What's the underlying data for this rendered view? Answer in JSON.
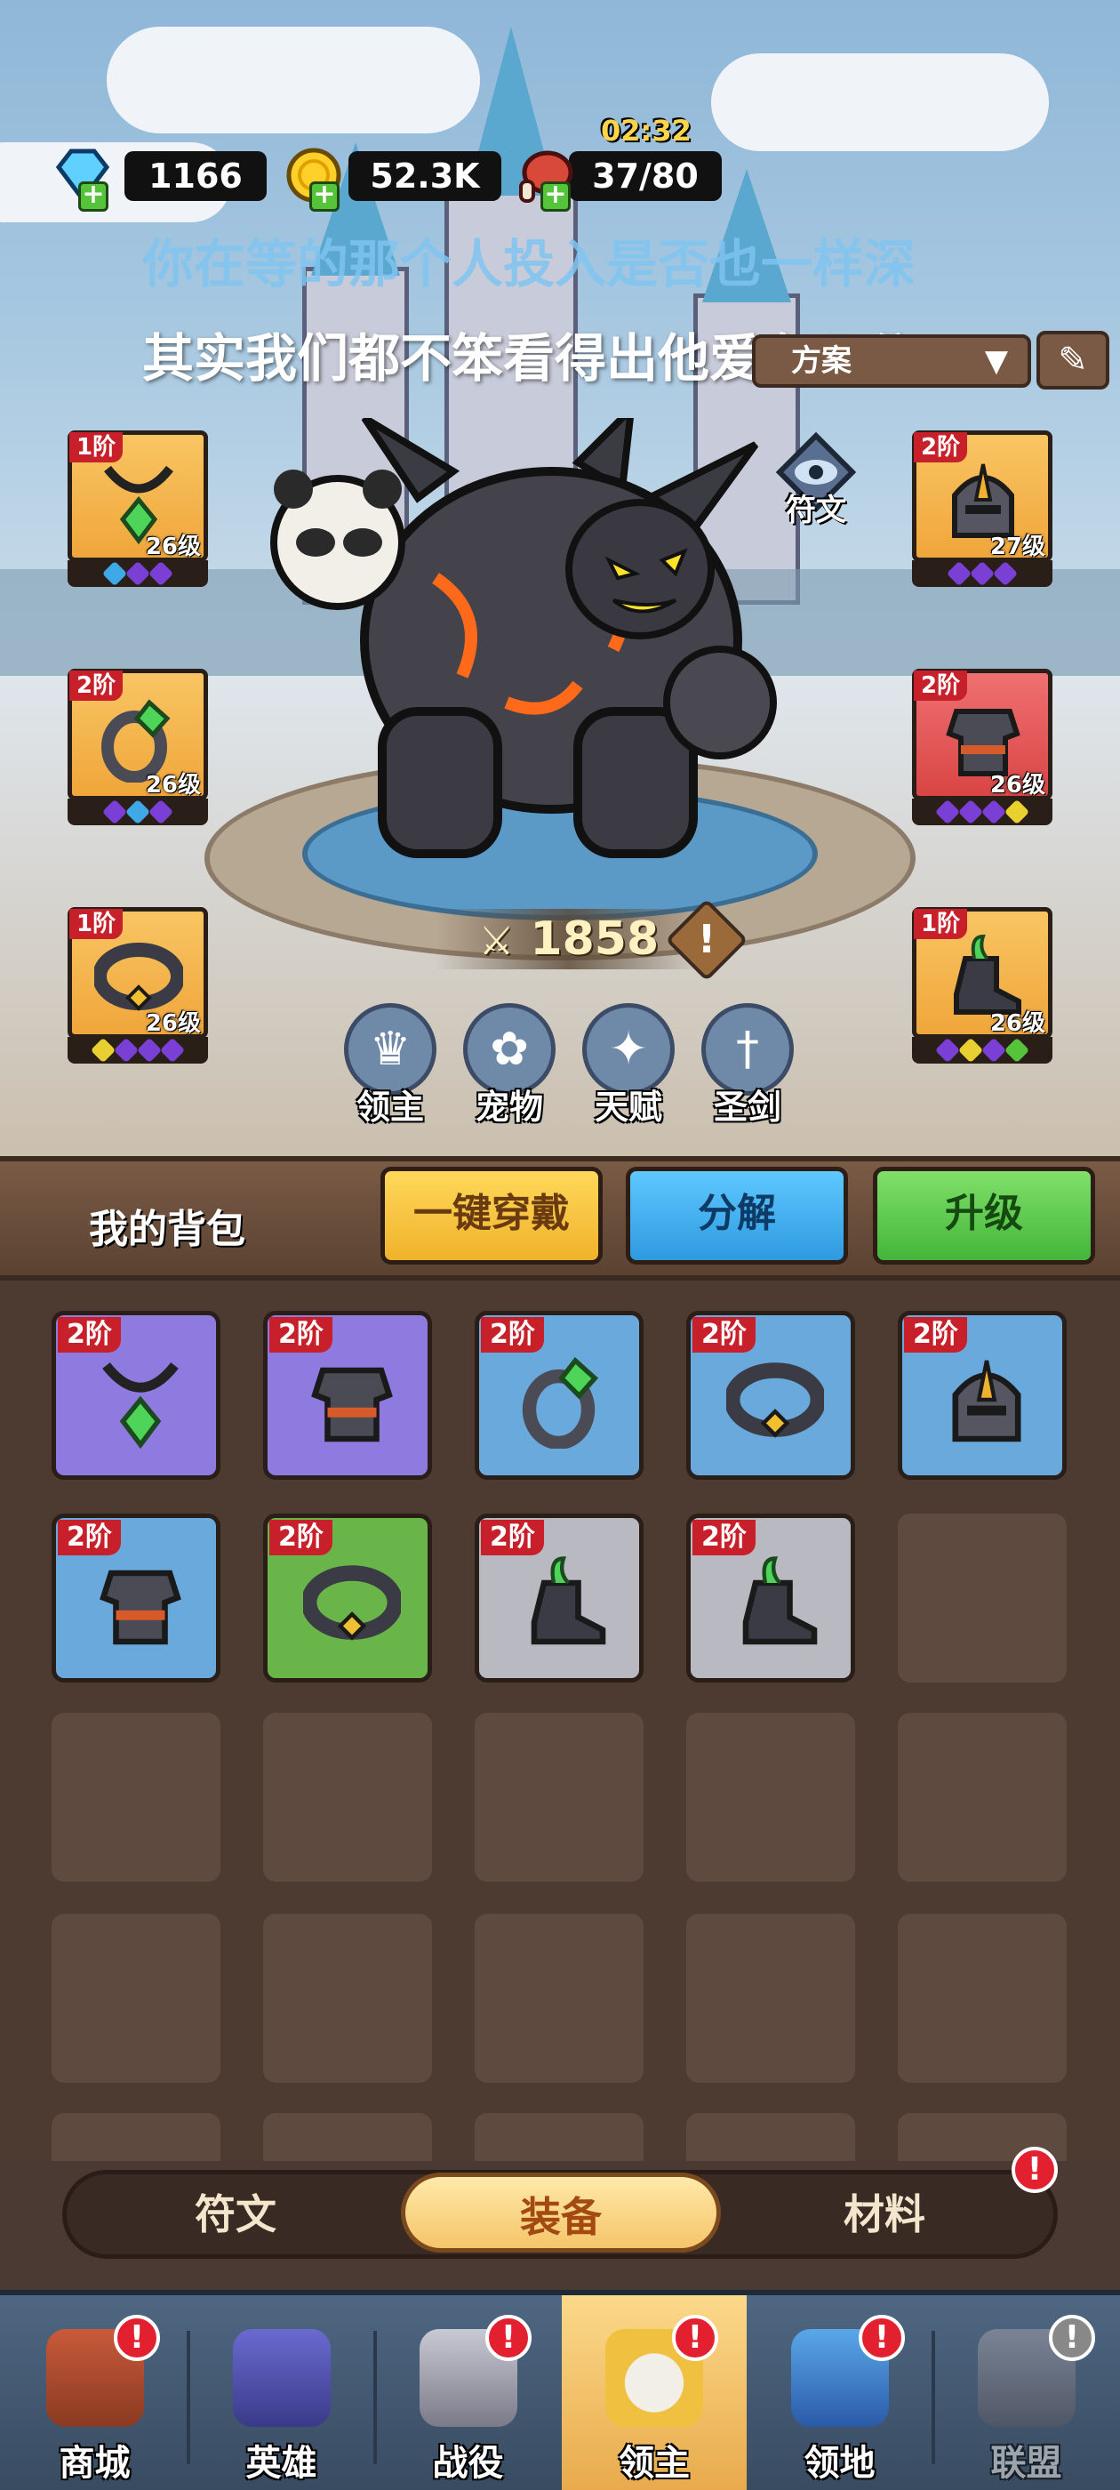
{
  "resources": {
    "gems": "1166",
    "gold": "52.3K",
    "stamina": "37/80",
    "stamina_timer": "02:32"
  },
  "lyrics": {
    "line1": "你在等的那个人投入是否也一样深",
    "line2": "其实我们都不笨看得出他爱有几分"
  },
  "preset": {
    "label": "方案"
  },
  "rune_label": "符文",
  "equipped": [
    {
      "slot": "necklace",
      "tier": "1阶",
      "level": "26级",
      "gems": [
        "#3fa9e8",
        "#7a3fd4",
        "#7a3fd4"
      ]
    },
    {
      "slot": "helmet",
      "tier": "2阶",
      "level": "27级",
      "gems": [
        "#7a3fd4",
        "#7a3fd4",
        "#7a3fd4"
      ]
    },
    {
      "slot": "ring",
      "tier": "2阶",
      "level": "26级",
      "gems": [
        "#7a3fd4",
        "#3fa9e8",
        "#7a3fd4"
      ]
    },
    {
      "slot": "armor",
      "tier": "2阶",
      "level": "26级",
      "gems": [
        "#7a3fd4",
        "#7a3fd4",
        "#7a3fd4",
        "#e8d030"
      ]
    },
    {
      "slot": "belt",
      "tier": "1阶",
      "level": "26级",
      "gems": [
        "#e8d030",
        "#7a3fd4",
        "#7a3fd4",
        "#7a3fd4"
      ]
    },
    {
      "slot": "boots",
      "tier": "1阶",
      "level": "26级",
      "gems": [
        "#7a3fd4",
        "#e8d030",
        "#7a3fd4",
        "#55c43a"
      ]
    }
  ],
  "power": "1858",
  "functions": [
    "领主",
    "宠物",
    "天赋",
    "圣剑"
  ],
  "bag": {
    "title": "我的背包",
    "btn_equip_all": "一键穿戴",
    "btn_decompose": "分解",
    "btn_upgrade": "升级"
  },
  "bag_items": [
    {
      "tier": "2阶",
      "item": "necklace",
      "rarity_color": "#8f7ae0"
    },
    {
      "tier": "2阶",
      "item": "armor",
      "rarity_color": "#8f7ae0"
    },
    {
      "tier": "2阶",
      "item": "ring",
      "rarity_color": "#6aa9dc"
    },
    {
      "tier": "2阶",
      "item": "belt",
      "rarity_color": "#6aa9dc"
    },
    {
      "tier": "2阶",
      "item": "helmet",
      "rarity_color": "#6aa9dc"
    },
    {
      "tier": "2阶",
      "item": "armor",
      "rarity_color": "#6aa9dc"
    },
    {
      "tier": "2阶",
      "item": "belt",
      "rarity_color": "#6ab54a"
    },
    {
      "tier": "2阶",
      "item": "boots",
      "rarity_color": "#b9b9c2"
    },
    {
      "tier": "2阶",
      "item": "boots",
      "rarity_color": "#b9b9c2"
    }
  ],
  "tabs": [
    "符文",
    "装备",
    "材料"
  ],
  "active_tab": "装备",
  "nav": [
    "商城",
    "英雄",
    "战役",
    "领主",
    "领地",
    "联盟"
  ],
  "active_nav": "领主"
}
